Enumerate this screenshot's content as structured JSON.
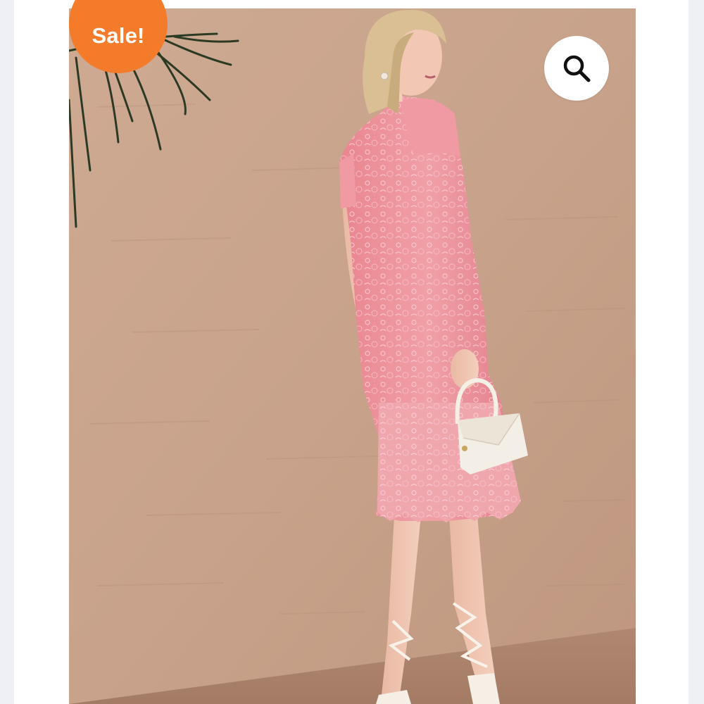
{
  "badge": {
    "label": "Sale!",
    "color": "#f47b29"
  },
  "gallery": {
    "zoom_icon": "search-icon",
    "image_icon": "product-photo"
  },
  "colors": {
    "wall": "#c8a28a",
    "floor": "#b88f76",
    "dress": "#ec8d99",
    "page_background": "#eef0f6",
    "card_background": "#ffffff"
  }
}
